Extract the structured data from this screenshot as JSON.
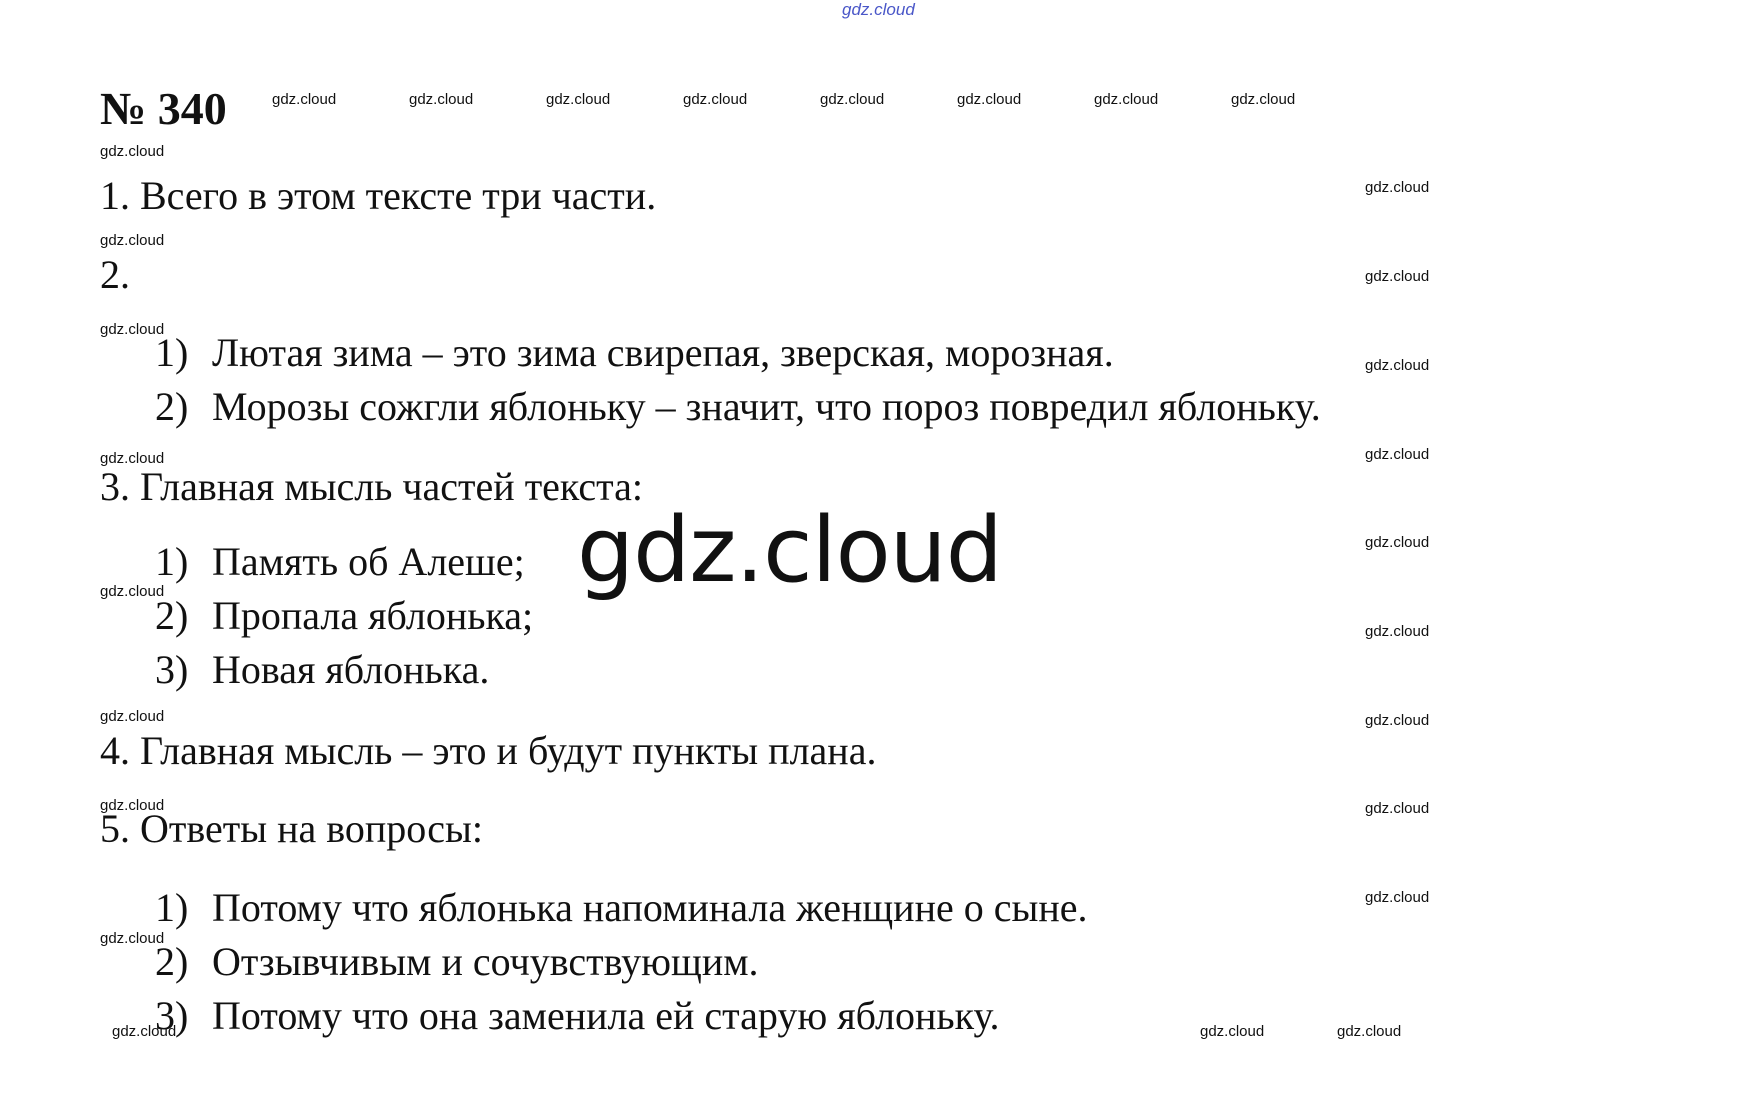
{
  "watermark_top": "gdz.cloud",
  "watermark_big": "gdz.cloud",
  "watermark_small": "gdz.cloud",
  "title": "№ 340",
  "p1": "1. Всего в этом тексте три части.",
  "p2": "2.",
  "p2_items": [
    {
      "num": "1)",
      "text": "Лютая зима – это зима свирепая, зверская, морозная."
    },
    {
      "num": "2)",
      "text": "Морозы сожгли яблоньку – значит, что пороз повредил яблоньку."
    }
  ],
  "p3": "3. Главная мысль частей текста:",
  "p3_items": [
    {
      "num": "1)",
      "text": "Память об Алеше;"
    },
    {
      "num": "2)",
      "text": "Пропала яблонька;"
    },
    {
      "num": "3)",
      "text": "Новая яблонька."
    }
  ],
  "p4": "4. Главная мысль – это и будут пункты плана.",
  "p5": "5. Ответы на вопросы:",
  "p5_items": [
    {
      "num": "1)",
      "text": "Потому что яблонька напоминала женщине о сыне."
    },
    {
      "num": "2)",
      "text": "Отзывчивым и сочувствующим."
    },
    {
      "num": "3)",
      "text": "Потому что она заменила ей старую яблоньку."
    }
  ]
}
